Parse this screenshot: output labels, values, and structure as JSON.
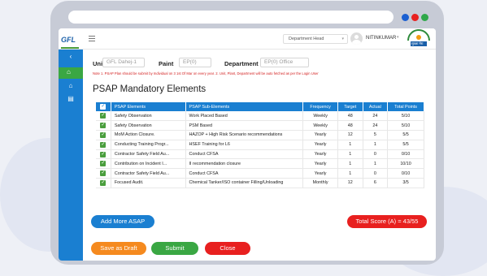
{
  "header": {
    "logo_text": "GFL",
    "role_select": "Department Head",
    "user_name": "NITINKUMAR",
    "brand_badge": "सुरक्षा मेरा"
  },
  "form": {
    "unit_label": "Unit",
    "unit_value": "GFL Dahej-1",
    "plant_label": "Paint",
    "plant_value": "EP(0)",
    "department_label": "Department",
    "department_value": "EP(0) Office"
  },
  "note": "Note 1. PSAP Plan should be submit by Individual on 3 1st Of Mar on every year. 2. Unit, Plant, Department will be auto fetched as per the Login User",
  "section_title": "PSAP Mandatory Elements",
  "table": {
    "headers": [
      "PSAP Elements",
      "PSAP Sub-Elements",
      "Frequency",
      "Target",
      "Actual",
      "Total Points"
    ],
    "rows": [
      [
        "Safety Observation",
        "Work Placed Based",
        "Weekly",
        "48",
        "24",
        "5/10"
      ],
      [
        "Safety Observation",
        "PSM Based",
        "Weekly",
        "48",
        "24",
        "5/10"
      ],
      [
        "MoM Action Closure.",
        "HAZOP + High Risk Scenario recommendations",
        "Yearly",
        "12",
        "5",
        "5/5"
      ],
      [
        "Conducting Training Progr...",
        "HSEF Training for L6",
        "Yearly",
        "1",
        "1",
        "5/5"
      ],
      [
        "Contractor Safety Field Au...",
        "Conduct CFSA",
        "Yearly",
        "1",
        "0",
        "0/10"
      ],
      [
        "Contribution on Incident I...",
        "II recommendation closure",
        "Yearly",
        "1",
        "1",
        "10/10"
      ],
      [
        "Contractor Safety Field Au...",
        "Conduct CFSA",
        "Yearly",
        "1",
        "0",
        "0/10"
      ],
      [
        "Focused Audit.",
        "Chemical Tanker/ISO container Filling/Unloading",
        "Monthly",
        "12",
        "6",
        "3/5"
      ]
    ]
  },
  "buttons": {
    "add_more": "Add More ASAP",
    "total_score": "Total Score (A) = 43/55",
    "save_draft": "Save as Draft",
    "submit": "Submit",
    "close": "Close"
  },
  "colors": {
    "primary": "#1a7fd1",
    "danger": "#e8201f",
    "success": "#3aa743",
    "warning": "#f58a1f"
  }
}
